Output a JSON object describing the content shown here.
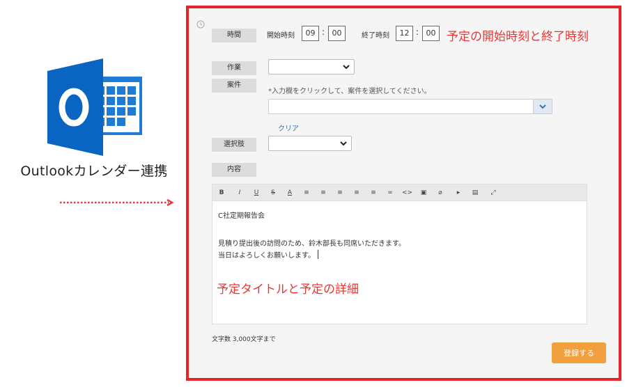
{
  "promo": {
    "caption": "Outlookカレンダー連携",
    "logo_icon": "outlook-logo-icon"
  },
  "colors": {
    "panel_border": "#e2262a",
    "annotation": "#e53935",
    "submit": "#f2a03d",
    "link": "#2a6ebb",
    "outlook_blue": "#0a64c1"
  },
  "form": {
    "time": {
      "label": "時間",
      "start_label": "開始時刻",
      "start_hour": "09",
      "start_min": "00",
      "end_label": "終了時刻",
      "end_hour": "12",
      "end_min": "00",
      "separator": ":"
    },
    "work": {
      "label": "作業",
      "value": ""
    },
    "project": {
      "label": "案件",
      "hint": "*入力欄をクリックして、案件を選択してください。",
      "value": "",
      "clear_link": "クリア"
    },
    "choice": {
      "label": "選択肢",
      "value": ""
    },
    "content": {
      "label": "内容",
      "toolbar": [
        "B",
        "I",
        "U",
        "S",
        "A",
        "≡",
        "≡",
        "≡",
        "≡",
        "≡",
        "∞",
        "<>",
        "▣",
        "⌀",
        "▸",
        "▤",
        "⤢"
      ],
      "lines": [
        "C社定期報告会",
        "",
        "見積り提出後の訪問のため、鈴木部長も同席いただきます。",
        "当日はよろしくお願いします。"
      ],
      "char_limit": "文字数 3,000文字まで"
    },
    "submit_label": "登録する"
  },
  "annotations": {
    "time_note": "予定の開始時刻と終了時刻",
    "content_note": "予定タイトルと予定の詳細"
  }
}
